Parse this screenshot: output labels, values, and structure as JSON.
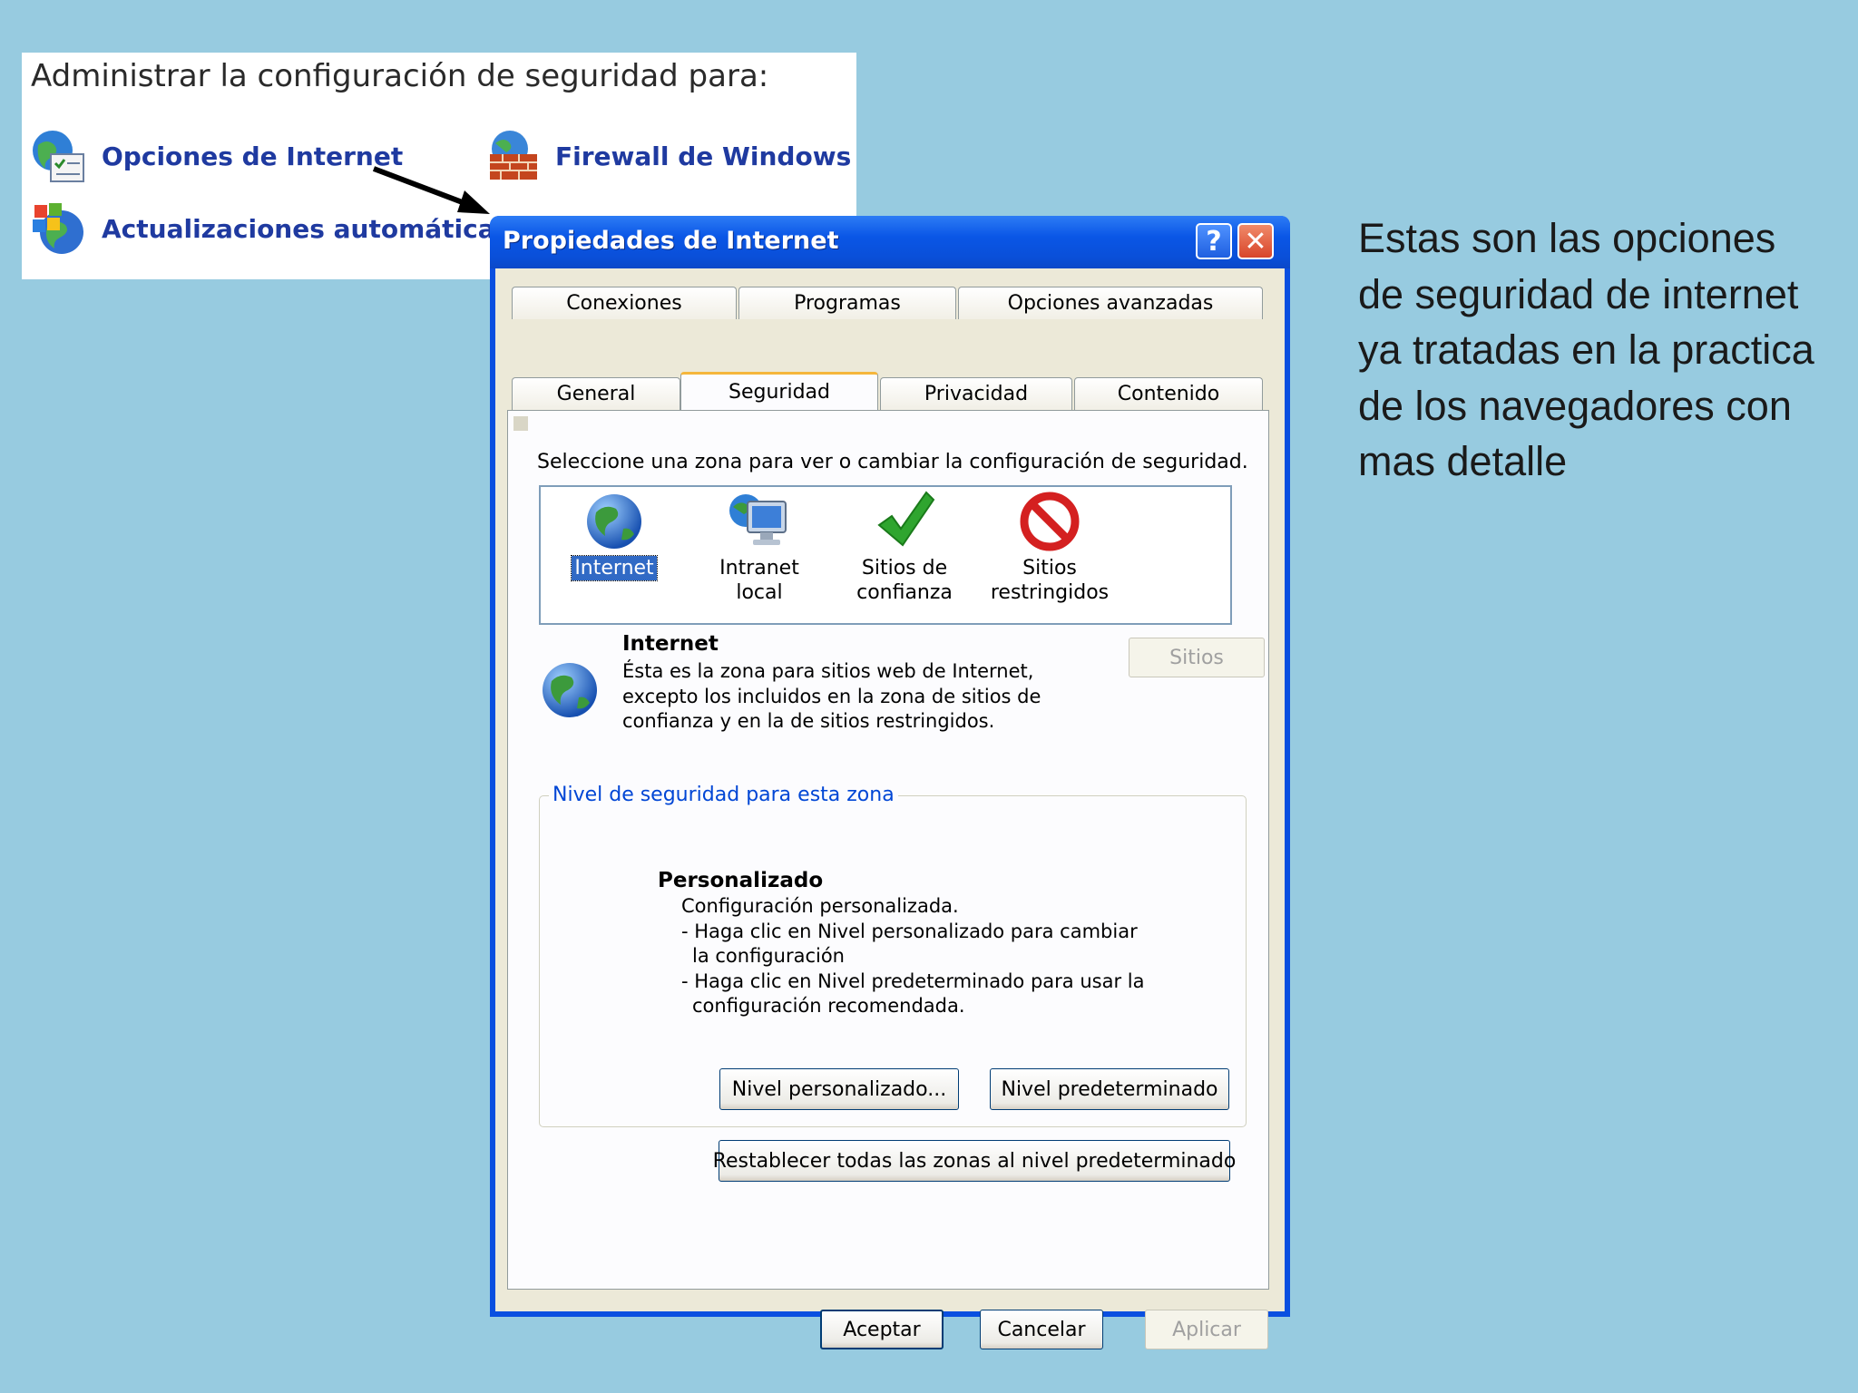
{
  "security_panel": {
    "title": "Administrar la configuración de seguridad para:",
    "links": {
      "internet_options": "Opciones de Internet",
      "firewall": "Firewall de Windows",
      "automatic_updates": "Actualizaciones automáticas"
    }
  },
  "slide_text": "Estas son las opciones de seguridad de internet ya tratadas en la practica de los navegadores con mas detalle",
  "dialog": {
    "title": "Propiedades de Internet",
    "help_glyph": "?",
    "close_glyph": "✕",
    "tabs_row1": [
      "Conexiones",
      "Programas",
      "Opciones avanzadas"
    ],
    "tabs_row2": [
      "General",
      "Seguridad",
      "Privacidad",
      "Contenido"
    ],
    "active_tab": "Seguridad",
    "zone_prompt": "Seleccione una zona para ver o cambiar la configuración de seguridad.",
    "zones": [
      {
        "line1": "Internet",
        "line2": "",
        "icon": "globe-icon"
      },
      {
        "line1": "Intranet local",
        "line2": "",
        "icon": "intranet-computer-icon"
      },
      {
        "line1": "Sitios de",
        "line2": "confianza",
        "icon": "checkmark-icon"
      },
      {
        "line1": "Sitios",
        "line2": "restringidos",
        "icon": "restricted-icon"
      }
    ],
    "selected_zone": "Internet",
    "zone_info": {
      "title": "Internet",
      "desc_lines": [
        "Ésta es la zona para sitios web de Internet,",
        "excepto los incluidos en la zona de sitios de",
        "confianza y en la de sitios restringidos."
      ],
      "sites_button": "Sitios"
    },
    "security_level": {
      "legend": "Nivel de seguridad para esta zona",
      "title": "Personalizado",
      "desc_lines": [
        "Configuración personalizada.",
        "- Haga clic en Nivel personalizado para cambiar",
        "la configuración",
        "- Haga clic en Nivel predeterminado para usar la",
        "configuración recomendada."
      ],
      "custom_button": "Nivel personalizado...",
      "default_button": "Nivel predeterminado"
    },
    "reset_button": "Restablecer todas las zonas al nivel predeterminado",
    "footer": {
      "ok": "Aceptar",
      "cancel": "Cancelar",
      "apply": "Aplicar"
    }
  },
  "colors": {
    "background": "#97cbe0",
    "titlebar": "#0a56e6",
    "link": "#1f3aa0",
    "selection": "#316ac5"
  }
}
